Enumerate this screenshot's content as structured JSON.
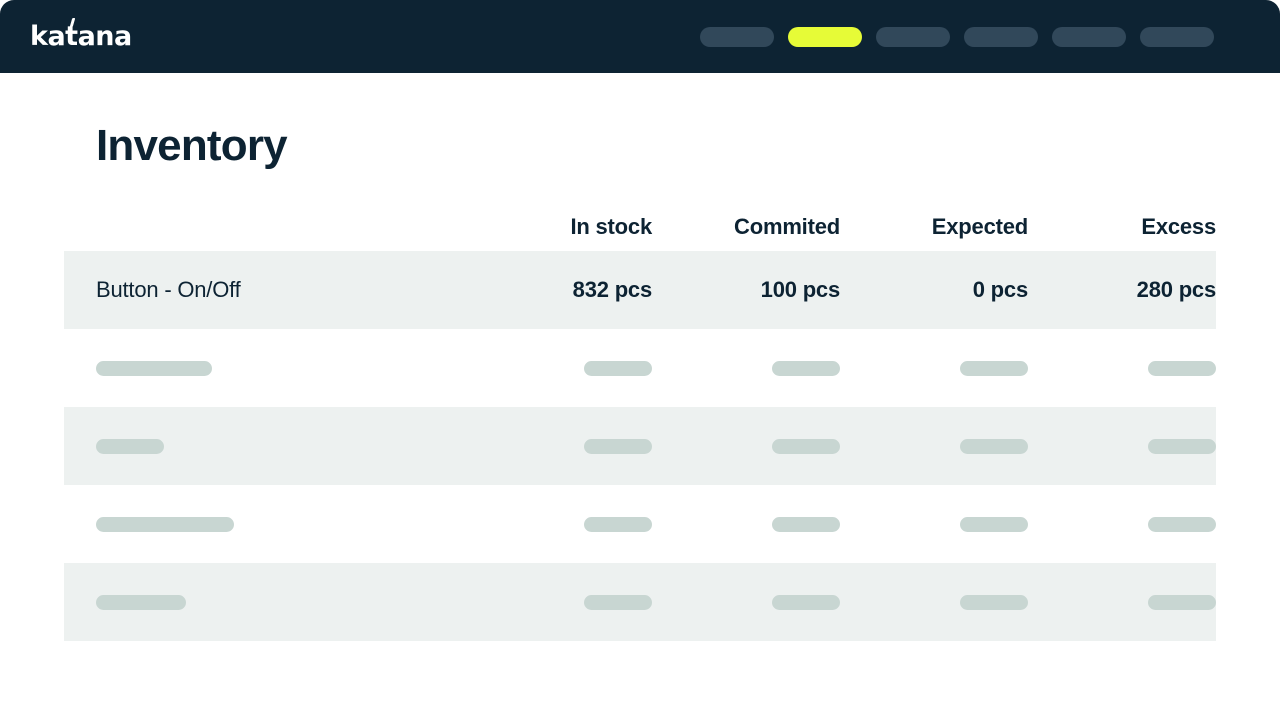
{
  "brand": {
    "name": "katana"
  },
  "topnav": {
    "items": [
      {
        "name": "nav-pill-1",
        "label": "",
        "width": 74,
        "active": false
      },
      {
        "name": "nav-pill-2",
        "label": "",
        "width": 74,
        "active": true
      },
      {
        "name": "nav-pill-3",
        "label": "",
        "width": 74,
        "active": false
      },
      {
        "name": "nav-pill-4",
        "label": "",
        "width": 74,
        "active": false
      },
      {
        "name": "nav-pill-5",
        "label": "",
        "width": 74,
        "active": false
      },
      {
        "name": "nav-pill-6",
        "label": "",
        "width": 74,
        "active": false
      }
    ]
  },
  "page": {
    "title": "Inventory"
  },
  "table": {
    "columns": [
      {
        "key": "name",
        "label": ""
      },
      {
        "key": "in_stock",
        "label": "In stock"
      },
      {
        "key": "commited",
        "label": "Commited"
      },
      {
        "key": "expected",
        "label": "Expected"
      },
      {
        "key": "excess",
        "label": "Excess"
      }
    ],
    "rows": [
      {
        "type": "data",
        "shaded": true,
        "name": "Button - On/Off",
        "in_stock": "832 pcs",
        "commited": "100 pcs",
        "expected": "0 pcs",
        "excess": "280 pcs"
      },
      {
        "type": "skeleton",
        "shaded": false,
        "name_width": 116
      },
      {
        "type": "skeleton",
        "shaded": true,
        "name_width": 68
      },
      {
        "type": "skeleton",
        "shaded": false,
        "name_width": 138
      },
      {
        "type": "skeleton",
        "shaded": true,
        "name_width": 90
      }
    ]
  },
  "colors": {
    "topbar_bg": "#0d2333",
    "accent_yellow": "#e6fb37",
    "pill_inactive": "#31485a",
    "row_shaded": "#edf1f0",
    "skeleton": "#c8d6d2",
    "text_primary": "#0d2333"
  }
}
